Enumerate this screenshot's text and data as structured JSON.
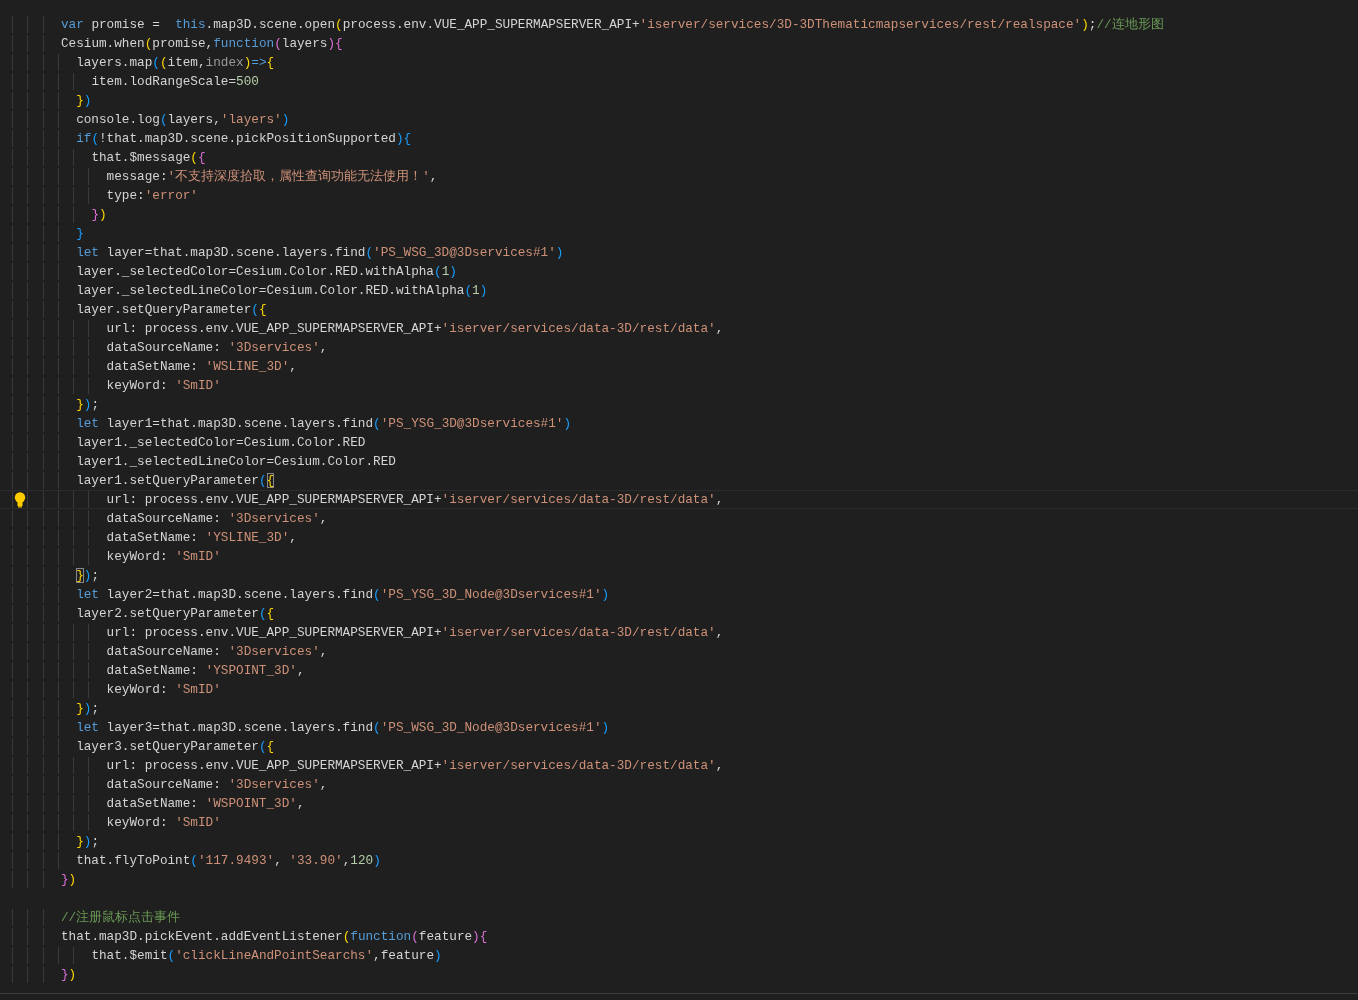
{
  "editor": {
    "lines": [
      {
        "kind": "code",
        "tokens": [
          {
            "kind": "k",
            "text": "        var"
          },
          {
            "kind": "p",
            "text": " promise =  "
          },
          {
            "kind": "k",
            "text": "this"
          },
          {
            "kind": "p",
            "text": ".map3D.scene.open"
          },
          {
            "kind": "b",
            "text": "("
          },
          {
            "kind": "p",
            "text": "process.env.VUE_APP_SUPERMAPSERVER_API+"
          },
          {
            "kind": "s",
            "text": "'iserver/services/3D-3DThematicmapservices/rest/realspace'"
          },
          {
            "kind": "b",
            "text": ")"
          },
          {
            "kind": "p",
            "text": ";"
          },
          {
            "kind": "c",
            "text": "//连地形图"
          }
        ]
      },
      {
        "kind": "code",
        "tokens": [
          {
            "kind": "p",
            "text": "        Cesium.when"
          },
          {
            "kind": "b",
            "text": "("
          },
          {
            "kind": "p",
            "text": "promise,"
          },
          {
            "kind": "k",
            "text": "function"
          },
          {
            "kind": "b",
            "text": "("
          },
          {
            "kind": "p",
            "text": "layers"
          },
          {
            "kind": "b",
            "text": ")"
          },
          {
            "kind": "b",
            "text": "{"
          }
        ]
      },
      {
        "kind": "code",
        "tokens": [
          {
            "kind": "p",
            "text": "          layers.map"
          },
          {
            "kind": "b",
            "text": "("
          },
          {
            "kind": "b",
            "text": "("
          },
          {
            "kind": "p",
            "text": "item,"
          },
          {
            "kind": "u",
            "text": "index"
          },
          {
            "kind": "b",
            "text": ")"
          },
          {
            "kind": "k",
            "text": "=>"
          },
          {
            "kind": "b",
            "text": "{"
          }
        ]
      },
      {
        "kind": "code",
        "tokens": [
          {
            "kind": "p",
            "text": "            item.lodRangeScale="
          },
          {
            "kind": "n",
            "text": "500"
          }
        ]
      },
      {
        "kind": "code",
        "tokens": [
          {
            "kind": "b",
            "text": "          }"
          },
          {
            "kind": "b",
            "text": ")"
          }
        ]
      },
      {
        "kind": "code",
        "tokens": [
          {
            "kind": "p",
            "text": "          console.log"
          },
          {
            "kind": "b",
            "text": "("
          },
          {
            "kind": "p",
            "text": "layers,"
          },
          {
            "kind": "s",
            "text": "'layers'"
          },
          {
            "kind": "b",
            "text": ")"
          }
        ]
      },
      {
        "kind": "code",
        "tokens": [
          {
            "kind": "k",
            "text": "          if"
          },
          {
            "kind": "b",
            "text": "("
          },
          {
            "kind": "p",
            "text": "!that.map3D.scene.pickPositionSupported"
          },
          {
            "kind": "b",
            "text": ")"
          },
          {
            "kind": "b",
            "text": "{"
          }
        ]
      },
      {
        "kind": "code",
        "tokens": [
          {
            "kind": "p",
            "text": "            that.$message"
          },
          {
            "kind": "b",
            "text": "("
          },
          {
            "kind": "b",
            "text": "{"
          }
        ]
      },
      {
        "kind": "code",
        "tokens": [
          {
            "kind": "p",
            "text": "              message:"
          },
          {
            "kind": "s",
            "text": "'不支持深度拾取，属性查询功能无法使用！'"
          },
          {
            "kind": "p",
            "text": ","
          }
        ]
      },
      {
        "kind": "code",
        "tokens": [
          {
            "kind": "p",
            "text": "              type:"
          },
          {
            "kind": "s",
            "text": "'error'"
          }
        ]
      },
      {
        "kind": "code",
        "tokens": [
          {
            "kind": "b",
            "text": "            }"
          },
          {
            "kind": "b",
            "text": ")"
          }
        ]
      },
      {
        "kind": "code",
        "tokens": [
          {
            "kind": "b",
            "text": "          }"
          }
        ]
      },
      {
        "kind": "code",
        "tokens": [
          {
            "kind": "k",
            "text": "          let"
          },
          {
            "kind": "p",
            "text": " layer=that.map3D.scene.layers.find"
          },
          {
            "kind": "b",
            "text": "("
          },
          {
            "kind": "s",
            "text": "'PS_WSG_3D@3Dservices#1'"
          },
          {
            "kind": "b",
            "text": ")"
          }
        ]
      },
      {
        "kind": "code",
        "tokens": [
          {
            "kind": "p",
            "text": "          layer._selectedColor=Cesium.Color.RED.withAlpha"
          },
          {
            "kind": "b",
            "text": "("
          },
          {
            "kind": "n",
            "text": "1"
          },
          {
            "kind": "b",
            "text": ")"
          }
        ]
      },
      {
        "kind": "code",
        "tokens": [
          {
            "kind": "p",
            "text": "          layer._selectedLineColor=Cesium.Color.RED.withAlpha"
          },
          {
            "kind": "b",
            "text": "("
          },
          {
            "kind": "n",
            "text": "1"
          },
          {
            "kind": "b",
            "text": ")"
          }
        ]
      },
      {
        "kind": "code",
        "tokens": [
          {
            "kind": "p",
            "text": "          layer.setQueryParameter"
          },
          {
            "kind": "b",
            "text": "("
          },
          {
            "kind": "b",
            "text": "{"
          }
        ]
      },
      {
        "kind": "code",
        "tokens": [
          {
            "kind": "p",
            "text": "              url: process.env.VUE_APP_SUPERMAPSERVER_API+"
          },
          {
            "kind": "s",
            "text": "'iserver/services/data-3D/rest/data'"
          },
          {
            "kind": "p",
            "text": ","
          }
        ]
      },
      {
        "kind": "code",
        "tokens": [
          {
            "kind": "p",
            "text": "              dataSourceName: "
          },
          {
            "kind": "s",
            "text": "'3Dservices'"
          },
          {
            "kind": "p",
            "text": ","
          }
        ]
      },
      {
        "kind": "code",
        "tokens": [
          {
            "kind": "p",
            "text": "              dataSetName: "
          },
          {
            "kind": "s",
            "text": "'WSLINE_3D'"
          },
          {
            "kind": "p",
            "text": ","
          }
        ]
      },
      {
        "kind": "code",
        "tokens": [
          {
            "kind": "p",
            "text": "              keyWord: "
          },
          {
            "kind": "s",
            "text": "'SmID'"
          }
        ]
      },
      {
        "kind": "code",
        "tokens": [
          {
            "kind": "b",
            "text": "          }"
          },
          {
            "kind": "b",
            "text": ")"
          },
          {
            "kind": "p",
            "text": ";"
          }
        ]
      },
      {
        "kind": "code",
        "tokens": [
          {
            "kind": "k",
            "text": "          let"
          },
          {
            "kind": "p",
            "text": " layer1=that.map3D.scene.layers.find"
          },
          {
            "kind": "b",
            "text": "("
          },
          {
            "kind": "s",
            "text": "'PS_YSG_3D@3Dservices#1'"
          },
          {
            "kind": "b",
            "text": ")"
          }
        ]
      },
      {
        "kind": "code",
        "tokens": [
          {
            "kind": "p",
            "text": "          layer1._selectedColor=Cesium.Color.RED"
          }
        ]
      },
      {
        "kind": "code",
        "tokens": [
          {
            "kind": "p",
            "text": "          layer1._selectedLineColor=Cesium.Color.RED"
          }
        ]
      },
      {
        "kind": "code",
        "tokens": [
          {
            "kind": "p",
            "text": "          layer1.setQueryParameter"
          },
          {
            "kind": "b",
            "text": "("
          },
          {
            "kind": "b",
            "text": "{",
            "match": true
          }
        ]
      },
      {
        "kind": "code",
        "current": true,
        "lightbulb": true,
        "tokens": [
          {
            "kind": "p",
            "text": "              url: process.env.VUE_APP_SUPERMAPSERVER_API+"
          },
          {
            "kind": "s",
            "text": "'iserver/services/data-3D/rest/data'"
          },
          {
            "kind": "p",
            "text": ","
          }
        ]
      },
      {
        "kind": "code",
        "tokens": [
          {
            "kind": "p",
            "text": "              dataSourceName: "
          },
          {
            "kind": "s",
            "text": "'3Dservices'"
          },
          {
            "kind": "p",
            "text": ","
          }
        ]
      },
      {
        "kind": "code",
        "tokens": [
          {
            "kind": "p",
            "text": "              dataSetName: "
          },
          {
            "kind": "s",
            "text": "'YSLINE_3D'"
          },
          {
            "kind": "p",
            "text": ","
          }
        ]
      },
      {
        "kind": "code",
        "tokens": [
          {
            "kind": "p",
            "text": "              keyWord: "
          },
          {
            "kind": "s",
            "text": "'SmID'"
          }
        ]
      },
      {
        "kind": "code",
        "tokens": [
          {
            "kind": "b",
            "text": "          }",
            "match": true
          },
          {
            "kind": "b",
            "text": ")"
          },
          {
            "kind": "p",
            "text": ";"
          }
        ]
      },
      {
        "kind": "code",
        "tokens": [
          {
            "kind": "k",
            "text": "          let"
          },
          {
            "kind": "p",
            "text": " layer2=that.map3D.scene.layers.find"
          },
          {
            "kind": "b",
            "text": "("
          },
          {
            "kind": "s",
            "text": "'PS_YSG_3D_Node@3Dservices#1'"
          },
          {
            "kind": "b",
            "text": ")"
          }
        ]
      },
      {
        "kind": "code",
        "tokens": [
          {
            "kind": "p",
            "text": "          layer2.setQueryParameter"
          },
          {
            "kind": "b",
            "text": "("
          },
          {
            "kind": "b",
            "text": "{"
          }
        ]
      },
      {
        "kind": "code",
        "tokens": [
          {
            "kind": "p",
            "text": "              url: process.env.VUE_APP_SUPERMAPSERVER_API+"
          },
          {
            "kind": "s",
            "text": "'iserver/services/data-3D/rest/data'"
          },
          {
            "kind": "p",
            "text": ","
          }
        ]
      },
      {
        "kind": "code",
        "tokens": [
          {
            "kind": "p",
            "text": "              dataSourceName: "
          },
          {
            "kind": "s",
            "text": "'3Dservices'"
          },
          {
            "kind": "p",
            "text": ","
          }
        ]
      },
      {
        "kind": "code",
        "tokens": [
          {
            "kind": "p",
            "text": "              dataSetName: "
          },
          {
            "kind": "s",
            "text": "'YSPOINT_3D'"
          },
          {
            "kind": "p",
            "text": ","
          }
        ]
      },
      {
        "kind": "code",
        "tokens": [
          {
            "kind": "p",
            "text": "              keyWord: "
          },
          {
            "kind": "s",
            "text": "'SmID'"
          }
        ]
      },
      {
        "kind": "code",
        "tokens": [
          {
            "kind": "b",
            "text": "          }"
          },
          {
            "kind": "b",
            "text": ")"
          },
          {
            "kind": "p",
            "text": ";"
          }
        ]
      },
      {
        "kind": "code",
        "tokens": [
          {
            "kind": "k",
            "text": "          let"
          },
          {
            "kind": "p",
            "text": " layer3=that.map3D.scene.layers.find"
          },
          {
            "kind": "b",
            "text": "("
          },
          {
            "kind": "s",
            "text": "'PS_WSG_3D_Node@3Dservices#1'"
          },
          {
            "kind": "b",
            "text": ")"
          }
        ]
      },
      {
        "kind": "code",
        "tokens": [
          {
            "kind": "p",
            "text": "          layer3.setQueryParameter"
          },
          {
            "kind": "b",
            "text": "("
          },
          {
            "kind": "b",
            "text": "{"
          }
        ]
      },
      {
        "kind": "code",
        "tokens": [
          {
            "kind": "p",
            "text": "              url: process.env.VUE_APP_SUPERMAPSERVER_API+"
          },
          {
            "kind": "s",
            "text": "'iserver/services/data-3D/rest/data'"
          },
          {
            "kind": "p",
            "text": ","
          }
        ]
      },
      {
        "kind": "code",
        "tokens": [
          {
            "kind": "p",
            "text": "              dataSourceName: "
          },
          {
            "kind": "s",
            "text": "'3Dservices'"
          },
          {
            "kind": "p",
            "text": ","
          }
        ]
      },
      {
        "kind": "code",
        "tokens": [
          {
            "kind": "p",
            "text": "              dataSetName: "
          },
          {
            "kind": "s",
            "text": "'WSPOINT_3D'"
          },
          {
            "kind": "p",
            "text": ","
          }
        ]
      },
      {
        "kind": "code",
        "tokens": [
          {
            "kind": "p",
            "text": "              keyWord: "
          },
          {
            "kind": "s",
            "text": "'SmID'"
          }
        ]
      },
      {
        "kind": "code",
        "tokens": [
          {
            "kind": "b",
            "text": "          }"
          },
          {
            "kind": "b",
            "text": ")"
          },
          {
            "kind": "p",
            "text": ";"
          }
        ]
      },
      {
        "kind": "code",
        "tokens": [
          {
            "kind": "p",
            "text": "          that.flyToPoint"
          },
          {
            "kind": "b",
            "text": "("
          },
          {
            "kind": "s",
            "text": "'117.9493'"
          },
          {
            "kind": "p",
            "text": ", "
          },
          {
            "kind": "s",
            "text": "'33.90'"
          },
          {
            "kind": "p",
            "text": ","
          },
          {
            "kind": "n",
            "text": "120"
          },
          {
            "kind": "b",
            "text": ")"
          }
        ]
      },
      {
        "kind": "code",
        "tokens": [
          {
            "kind": "b",
            "text": "        }"
          },
          {
            "kind": "b",
            "text": ")"
          }
        ]
      },
      {
        "kind": "blank"
      },
      {
        "kind": "code",
        "tokens": [
          {
            "kind": "c",
            "text": "        //注册鼠标点击事件"
          }
        ]
      },
      {
        "kind": "code",
        "tokens": [
          {
            "kind": "p",
            "text": "        that.map3D.pickEvent.addEventListener"
          },
          {
            "kind": "b",
            "text": "("
          },
          {
            "kind": "k",
            "text": "function"
          },
          {
            "kind": "b",
            "text": "("
          },
          {
            "kind": "p",
            "text": "feature"
          },
          {
            "kind": "b",
            "text": ")"
          },
          {
            "kind": "b",
            "text": "{"
          }
        ]
      },
      {
        "kind": "code",
        "tokens": [
          {
            "kind": "p",
            "text": "            that.$emit"
          },
          {
            "kind": "b",
            "text": "("
          },
          {
            "kind": "s",
            "text": "'clickLineAndPointSearchs'"
          },
          {
            "kind": "p",
            "text": ",feature"
          },
          {
            "kind": "b",
            "text": ")"
          }
        ]
      },
      {
        "kind": "code",
        "tokens": [
          {
            "kind": "b",
            "text": "        }"
          },
          {
            "kind": "b",
            "text": ")"
          }
        ]
      }
    ]
  }
}
